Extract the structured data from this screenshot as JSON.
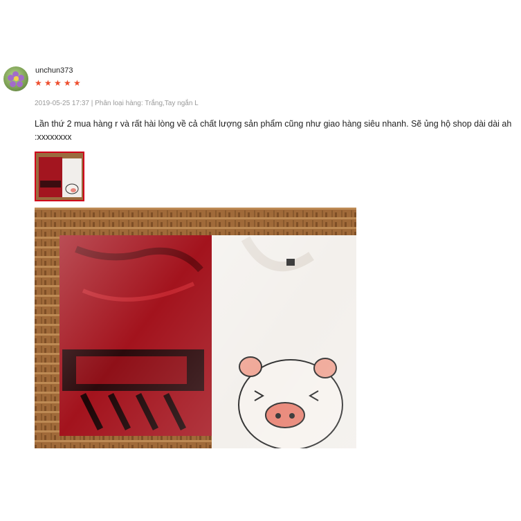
{
  "review": {
    "username": "unchun373",
    "rating": 5,
    "max_rating": 5,
    "date": "2019-05-25 17:37",
    "separator": "|",
    "variation_label": "Phân loại hàng:",
    "variation_value": "Trắng,Tay ngắn L",
    "comment_line1": "Lần thứ 2 mua hàng r và rất hài lòng về cả chất lượng sản phẩm cũng như giao hàng siêu nhanh. Sẽ ủng hộ shop dài dài ah",
    "comment_line2": ":xxxxxxxx"
  },
  "colors": {
    "star": "#ee4d2d",
    "thumb_border": "#d0011b"
  },
  "icons": [
    "avatar-flower",
    "star-icon"
  ]
}
